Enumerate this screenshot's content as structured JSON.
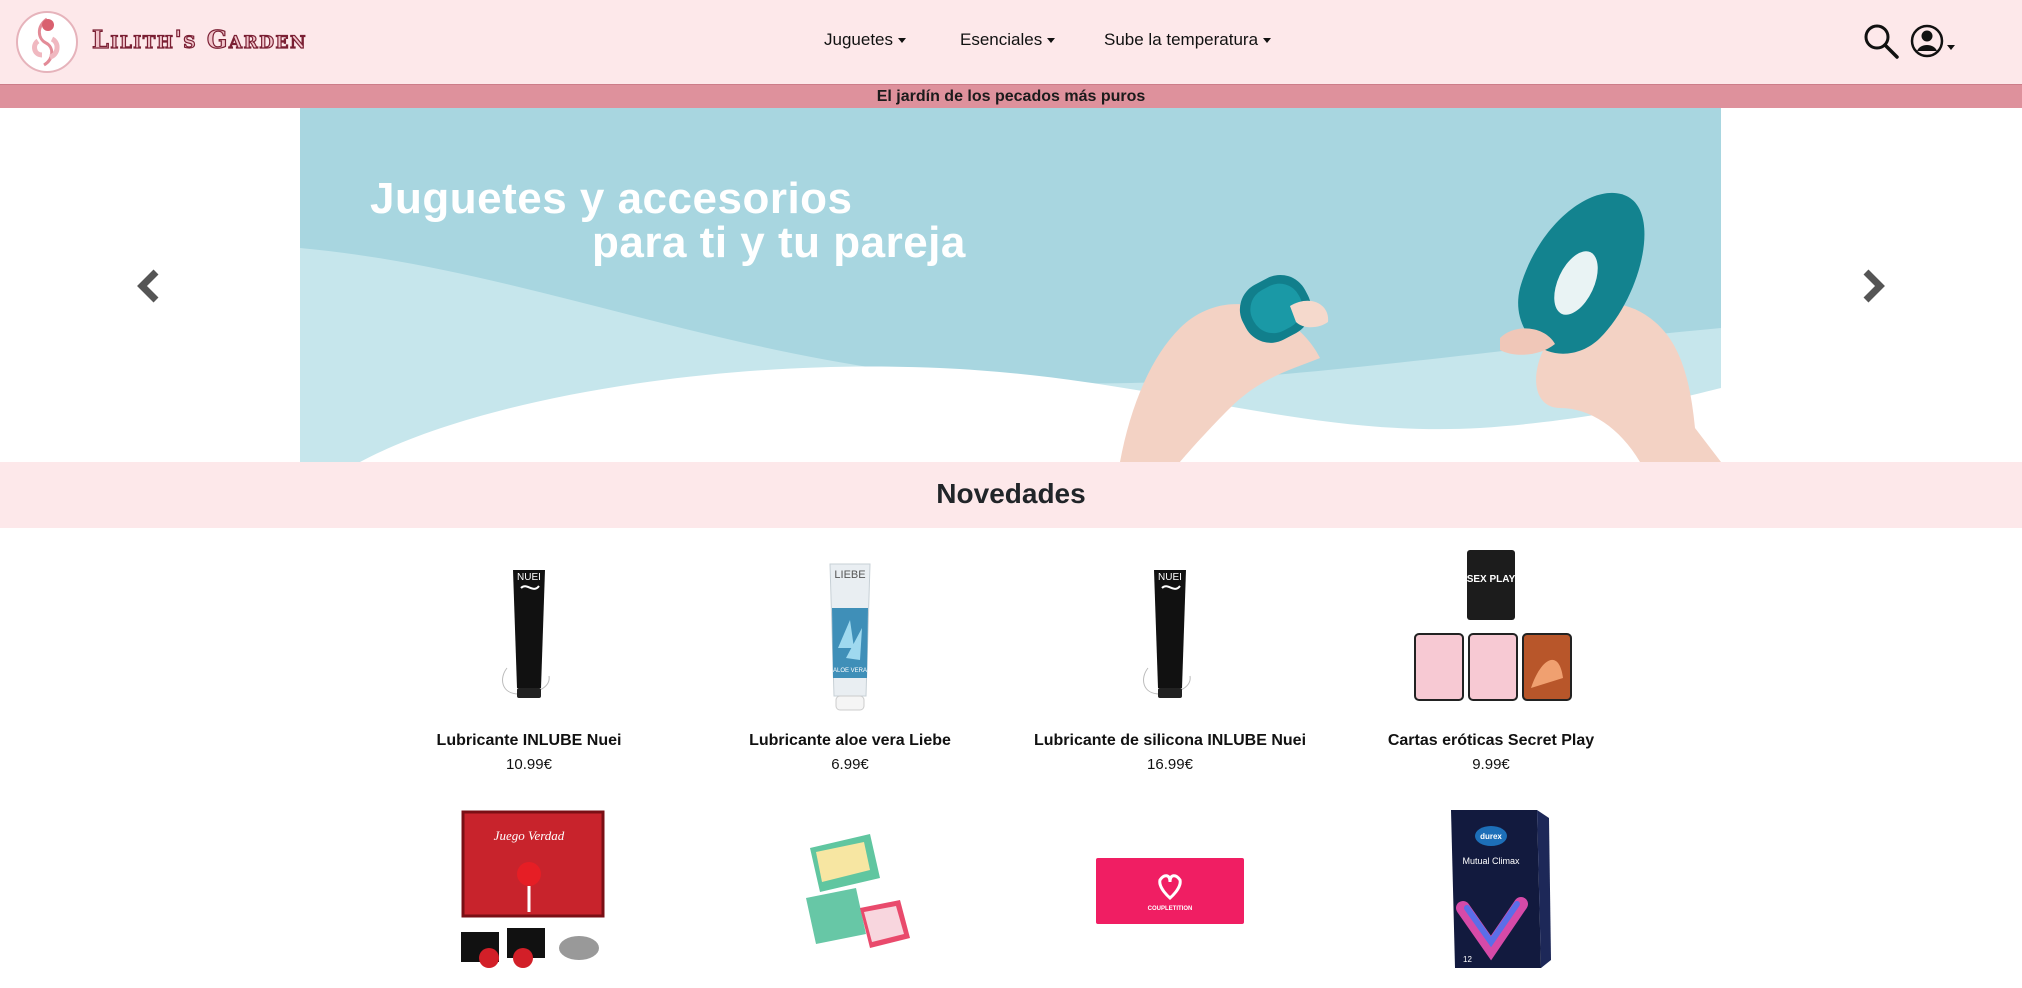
{
  "header": {
    "brand": "Lilith's Garden",
    "nav": [
      {
        "label": "Juguetes"
      },
      {
        "label": "Esenciales"
      },
      {
        "label": "Sube la temperatura"
      }
    ]
  },
  "tagline": "El jardín de los pecados más puros",
  "carousel": {
    "line1": "Juguetes y accesorios",
    "line2": "para ti y tu pareja"
  },
  "section": {
    "title": "Novedades"
  },
  "products": [
    {
      "name": "Lubricante INLUBE Nuei",
      "price": "10.99€"
    },
    {
      "name": "Lubricante aloe vera Liebe",
      "price": "6.99€"
    },
    {
      "name": "Lubricante de silicona INLUBE Nuei",
      "price": "16.99€"
    },
    {
      "name": "Cartas eróticas Secret Play",
      "price": "9.99€"
    }
  ],
  "product_images": {
    "nuei_label": "NUEI",
    "liebe_label": "LIEBE",
    "aloe_label": "ALOE VERA",
    "sexplay_label": "SEX PLAY",
    "durex_brand": "durex",
    "durex_product": "Mutual Climax",
    "durex_count": "12",
    "juego_title": "Juego Verdad",
    "condom_brand": "COUPLETITION"
  },
  "colors": {
    "header_bg": "#fde8ea",
    "strip_bg": "#de919c",
    "slide_bg": "#a8d6e0",
    "brand_stroke": "#7a1f33"
  }
}
